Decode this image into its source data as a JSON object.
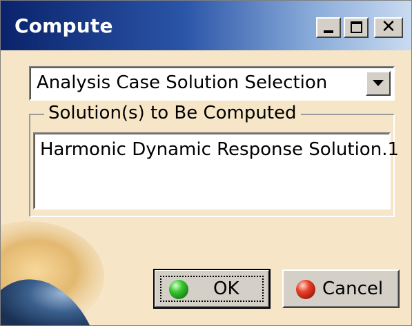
{
  "window": {
    "title": "Compute",
    "controls": {
      "minimize": "minimize-icon",
      "maximize": "maximize-icon",
      "close": "close-icon",
      "close_glyph": "✕"
    }
  },
  "dropdown": {
    "selected": "Analysis Case Solution Selection",
    "arrow_icon": "chevron-down-icon"
  },
  "group": {
    "label": "Solution(s) to Be Computed",
    "items": [
      "Harmonic Dynamic Response Solution.1"
    ]
  },
  "buttons": {
    "ok_label": "OK",
    "ok_icon": "green-ball-icon",
    "cancel_label": "Cancel",
    "cancel_icon": "red-ball-icon"
  },
  "colors": {
    "dialog_background": "#f6e6c7",
    "titlebar_start": "#0a236b",
    "titlebar_end": "#c9dbf1",
    "button_face": "#d4d0c8"
  }
}
